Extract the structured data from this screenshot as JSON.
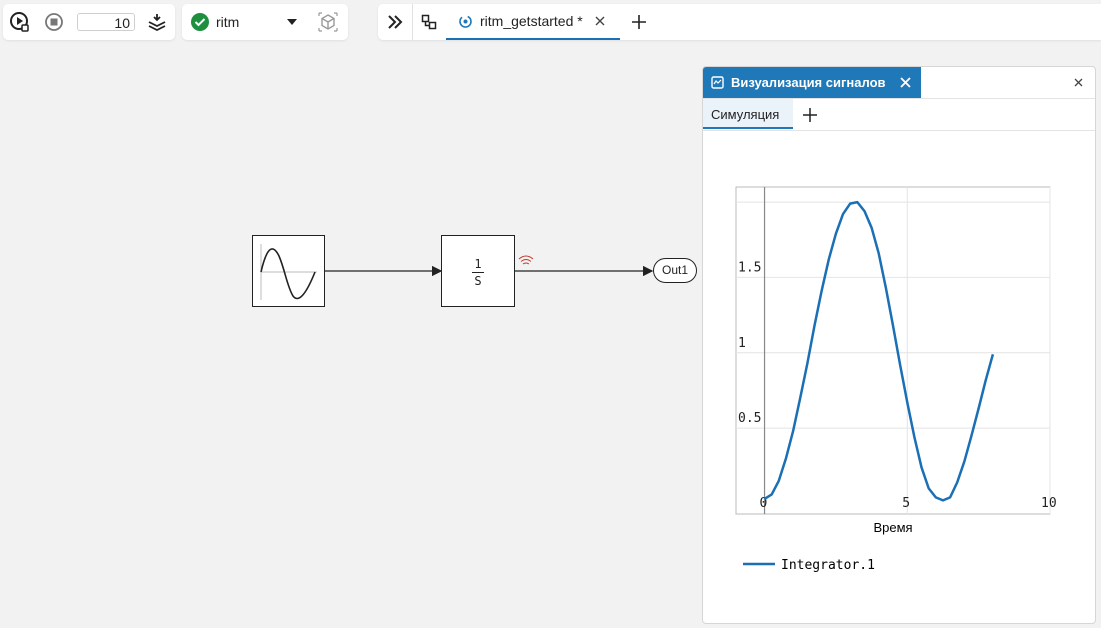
{
  "toolbar": {
    "stop_time": "10",
    "model_name": "ritm",
    "tab_title": "ritm_getstarted *"
  },
  "diagram": {
    "integrator_numerator": "1",
    "integrator_denominator": "S",
    "outport_label": "Out1"
  },
  "viewer": {
    "title": "Визуализация сигналов",
    "tab_label": "Симуляция"
  },
  "chart_data": {
    "type": "line",
    "xlabel": "Время",
    "ylabel": "",
    "xlim": [
      -1,
      10
    ],
    "ylim": [
      -0.07,
      2.1
    ],
    "x_ticks": [
      "0",
      "5",
      "10"
    ],
    "y_ticks": [
      "0.5",
      "1",
      "1.5"
    ],
    "y_tick_values": [
      0.5,
      1,
      1.5
    ],
    "x_tick_values": [
      0,
      5,
      10
    ],
    "grid": true,
    "legend_position": "bottom-left",
    "color": "#1a6fb5",
    "series": [
      {
        "name": "Integrator.1",
        "x": [
          0,
          0.25,
          0.5,
          0.75,
          1,
          1.25,
          1.5,
          1.75,
          2,
          2.25,
          2.5,
          2.75,
          3,
          3.25,
          3.5,
          3.75,
          4,
          4.25,
          4.5,
          4.75,
          5,
          5.25,
          5.5,
          5.75,
          6,
          6.25,
          6.5,
          6.75,
          7,
          7.25,
          7.5,
          7.75,
          8
        ],
        "y": [
          0.03,
          0.06,
          0.15,
          0.3,
          0.48,
          0.7,
          0.93,
          1.18,
          1.41,
          1.62,
          1.79,
          1.92,
          1.99,
          2.0,
          1.94,
          1.83,
          1.66,
          1.43,
          1.18,
          0.92,
          0.67,
          0.44,
          0.24,
          0.1,
          0.04,
          0.02,
          0.04,
          0.14,
          0.28,
          0.45,
          0.63,
          0.82,
          0.99
        ]
      }
    ]
  }
}
